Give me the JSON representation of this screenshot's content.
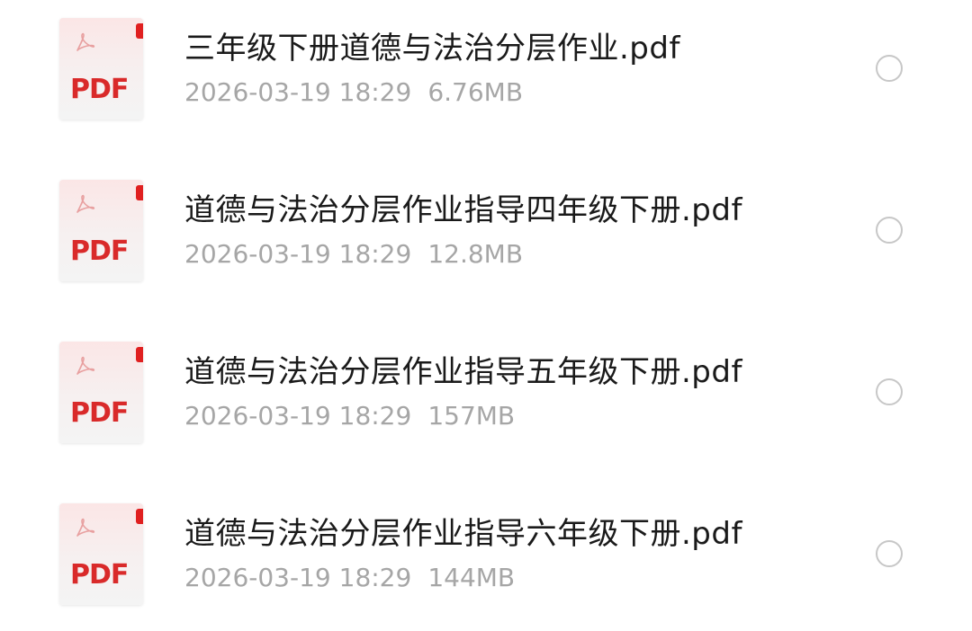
{
  "files": [
    {
      "name": "三年级下册道德与法治分层作业.pdf",
      "date": "2026-03-19 18:29",
      "size": "6.76MB",
      "icon": "pdf-file-icon",
      "icon_label": "PDF",
      "selected": false
    },
    {
      "name": "道德与法治分层作业指导四年级下册.pdf",
      "date": "2026-03-19 18:29",
      "size": "12.8MB",
      "icon": "pdf-file-icon",
      "icon_label": "PDF",
      "selected": false
    },
    {
      "name": "道德与法治分层作业指导五年级下册.pdf",
      "date": "2026-03-19 18:29",
      "size": "157MB",
      "icon": "pdf-file-icon",
      "icon_label": "PDF",
      "selected": false
    },
    {
      "name": "道德与法治分层作业指导六年级下册.pdf",
      "date": "2026-03-19 18:29",
      "size": "144MB",
      "icon": "pdf-file-icon",
      "icon_label": "PDF",
      "selected": false
    }
  ],
  "colors": {
    "pdf_red": "#d92a2a",
    "title_text": "#1a1a1a",
    "meta_text": "#a6a6a6",
    "radio_border": "#c7c7c7"
  }
}
